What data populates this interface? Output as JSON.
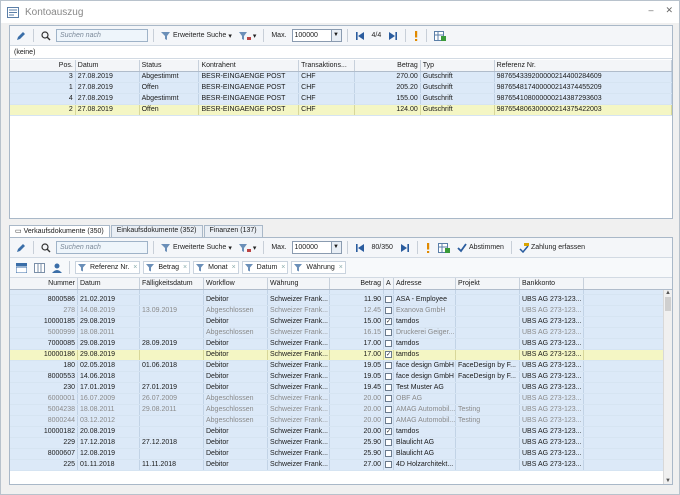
{
  "window": {
    "title": "Kontoauszug",
    "minimize": "–",
    "close": "✕"
  },
  "top": {
    "toolbar": {
      "search_placeholder": "Suchen nach",
      "advanced_search": "Erweiterte Suche",
      "max_label": "Max.",
      "max_value": "100000",
      "page": "4/4"
    },
    "filter_text": "(keine)",
    "columns": [
      "Pos.",
      "Datum",
      "Status",
      "Kontrahent",
      "Transaktions...",
      "Betrag",
      "Typ",
      "Referenz Nr."
    ],
    "rows": [
      {
        "pos": "3",
        "datum": "27.08.2019",
        "status": "Abgestimmt",
        "kontrahent": "BESR-EINGAENGE POST",
        "trans": "CHF",
        "betrag": "270.00",
        "typ": "Gutschrift",
        "ref": "987654339200000214400284609"
      },
      {
        "pos": "1",
        "datum": "27.08.2019",
        "status": "Offen",
        "kontrahent": "BESR-EINGAENGE POST",
        "trans": "CHF",
        "betrag": "205.20",
        "typ": "Gutschrift",
        "ref": "987654817400000214374455209"
      },
      {
        "pos": "4",
        "datum": "27.08.2019",
        "status": "Abgestimmt",
        "kontrahent": "BESR-EINGAENGE POST",
        "trans": "CHF",
        "betrag": "155.00",
        "typ": "Gutschrift",
        "ref": "987654108000000214387293603"
      },
      {
        "pos": "2",
        "datum": "27.08.2019",
        "status": "Offen",
        "kontrahent": "BESR-EINGAENGE POST",
        "trans": "CHF",
        "betrag": "124.00",
        "typ": "Gutschrift",
        "ref": "987654806300000214375422003"
      }
    ]
  },
  "tabs": [
    "Verkaufsdokumente (350)",
    "Einkaufsdokumente (352)",
    "Finanzen (137)"
  ],
  "bottom": {
    "toolbar": {
      "search_placeholder": "Suchen nach",
      "advanced_search": "Erweiterte Suche",
      "max_label": "Max.",
      "max_value": "100000",
      "page": "80/350",
      "abstimmen": "Abstimmen",
      "zahlung": "Zahlung erfassen"
    },
    "group_chips": [
      "Referenz Nr.",
      "Betrag",
      "Monat",
      "Datum",
      "Währung"
    ],
    "columns": [
      "Nummer",
      "Datum",
      "Fälligkeitsdatum",
      "Workflow",
      "Währung",
      "Betrag",
      "A",
      "Adresse",
      "Projekt",
      "Bankkonto"
    ],
    "rows": [
      {
        "nr": "",
        "datum": "",
        "faellig": "",
        "wf": "",
        "wae": "",
        "betrag": "",
        "a": "",
        "adresse": "",
        "projekt": "",
        "bank": "",
        "grey": false,
        "sel": false
      },
      {
        "nr": "8000586",
        "datum": "21.02.2019",
        "faellig": "",
        "wf": "Debitor",
        "wae": "Schweizer Frank...",
        "betrag": "11.90",
        "a": "",
        "adresse": "ASA - Employee",
        "projekt": "",
        "bank": "UBS AG 273-123...",
        "grey": false,
        "sel": false
      },
      {
        "nr": "278",
        "datum": "14.08.2019",
        "faellig": "13.09.2019",
        "wf": "Abgeschlossen",
        "wae": "Schweizer Frank...",
        "betrag": "12.45",
        "a": "",
        "adresse": "Exanova GmbH",
        "projekt": "",
        "bank": "UBS AG 273-123...",
        "grey": true,
        "sel": false
      },
      {
        "nr": "10000185",
        "datum": "29.08.2019",
        "faellig": "",
        "wf": "Debitor",
        "wae": "Schweizer Frank...",
        "betrag": "15.00",
        "a": "✓",
        "adresse": "tamdos",
        "projekt": "",
        "bank": "UBS AG 273-123...",
        "grey": false,
        "sel": false
      },
      {
        "nr": "5000999",
        "datum": "18.08.2011",
        "faellig": "",
        "wf": "Abgeschlossen",
        "wae": "Schweizer Frank...",
        "betrag": "16.15",
        "a": "",
        "adresse": "Druckerei Geiger...",
        "projekt": "",
        "bank": "UBS AG 273-123...",
        "grey": true,
        "sel": false
      },
      {
        "nr": "7000085",
        "datum": "29.08.2019",
        "faellig": "28.09.2019",
        "wf": "Debitor",
        "wae": "Schweizer Frank...",
        "betrag": "17.00",
        "a": "",
        "adresse": "tamdos",
        "projekt": "",
        "bank": "UBS AG 273-123...",
        "grey": false,
        "sel": false
      },
      {
        "nr": "10000186",
        "datum": "29.08.2019",
        "faellig": "",
        "wf": "Debitor",
        "wae": "Schweizer Frank...",
        "betrag": "17.00",
        "a": "✓",
        "adresse": "tamdos",
        "projekt": "",
        "bank": "UBS AG 273-123...",
        "grey": false,
        "sel": true
      },
      {
        "nr": "180",
        "datum": "02.05.2018",
        "faellig": "01.06.2018",
        "wf": "Debitor",
        "wae": "Schweizer Frank...",
        "betrag": "19.05",
        "a": "",
        "adresse": "face design GmbH",
        "projekt": "FaceDesign by F...",
        "bank": "UBS AG 273-123...",
        "grey": false,
        "sel": false
      },
      {
        "nr": "8000553",
        "datum": "14.06.2018",
        "faellig": "",
        "wf": "Debitor",
        "wae": "Schweizer Frank...",
        "betrag": "19.05",
        "a": "",
        "adresse": "face design GmbH",
        "projekt": "FaceDesign by F...",
        "bank": "UBS AG 273-123...",
        "grey": false,
        "sel": false
      },
      {
        "nr": "230",
        "datum": "17.01.2019",
        "faellig": "27.01.2019",
        "wf": "Debitor",
        "wae": "Schweizer Frank...",
        "betrag": "19.45",
        "a": "",
        "adresse": "Test Muster AG",
        "projekt": "",
        "bank": "UBS AG 273-123...",
        "grey": false,
        "sel": false
      },
      {
        "nr": "6000001",
        "datum": "16.07.2009",
        "faellig": "26.07.2009",
        "wf": "Abgeschlossen",
        "wae": "Schweizer Frank...",
        "betrag": "20.00",
        "a": "",
        "adresse": "OBF AG",
        "projekt": "",
        "bank": "UBS AG 273-123...",
        "grey": true,
        "sel": false
      },
      {
        "nr": "5004238",
        "datum": "18.08.2011",
        "faellig": "29.08.2011",
        "wf": "Abgeschlossen",
        "wae": "Schweizer Frank...",
        "betrag": "20.00",
        "a": "",
        "adresse": "AMAG Automobil...",
        "projekt": "Testing",
        "bank": "UBS AG 273-123...",
        "grey": true,
        "sel": false
      },
      {
        "nr": "8000244",
        "datum": "03.12.2012",
        "faellig": "",
        "wf": "Abgeschlossen",
        "wae": "Schweizer Frank...",
        "betrag": "20.00",
        "a": "",
        "adresse": "AMAG Automobil...",
        "projekt": "Testing",
        "bank": "UBS AG 273-123...",
        "grey": true,
        "sel": false
      },
      {
        "nr": "10000182",
        "datum": "20.08.2019",
        "faellig": "",
        "wf": "Debitor",
        "wae": "Schweizer Frank...",
        "betrag": "20.00",
        "a": "✓",
        "adresse": "tamdos",
        "projekt": "",
        "bank": "UBS AG 273-123...",
        "grey": false,
        "sel": false
      },
      {
        "nr": "229",
        "datum": "17.12.2018",
        "faellig": "27.12.2018",
        "wf": "Debitor",
        "wae": "Schweizer Frank...",
        "betrag": "25.90",
        "a": "",
        "adresse": "Blaulicht AG",
        "projekt": "",
        "bank": "UBS AG 273-123...",
        "grey": false,
        "sel": false
      },
      {
        "nr": "8000607",
        "datum": "12.08.2019",
        "faellig": "",
        "wf": "Debitor",
        "wae": "Schweizer Frank...",
        "betrag": "25.90",
        "a": "",
        "adresse": "Blaulicht AG",
        "projekt": "",
        "bank": "UBS AG 273-123...",
        "grey": false,
        "sel": false
      },
      {
        "nr": "225",
        "datum": "01.11.2018",
        "faellig": "11.11.2018",
        "wf": "Debitor",
        "wae": "Schweizer Frank...",
        "betrag": "27.00",
        "a": "",
        "adresse": "4D Holzarchitekt...",
        "projekt": "",
        "bank": "UBS AG 273-123...",
        "grey": false,
        "sel": false
      }
    ]
  },
  "colors": {
    "row_bg": "#dce9f8",
    "selected_row": "#f4f6c4",
    "header_bg": "#f3f5f8"
  }
}
